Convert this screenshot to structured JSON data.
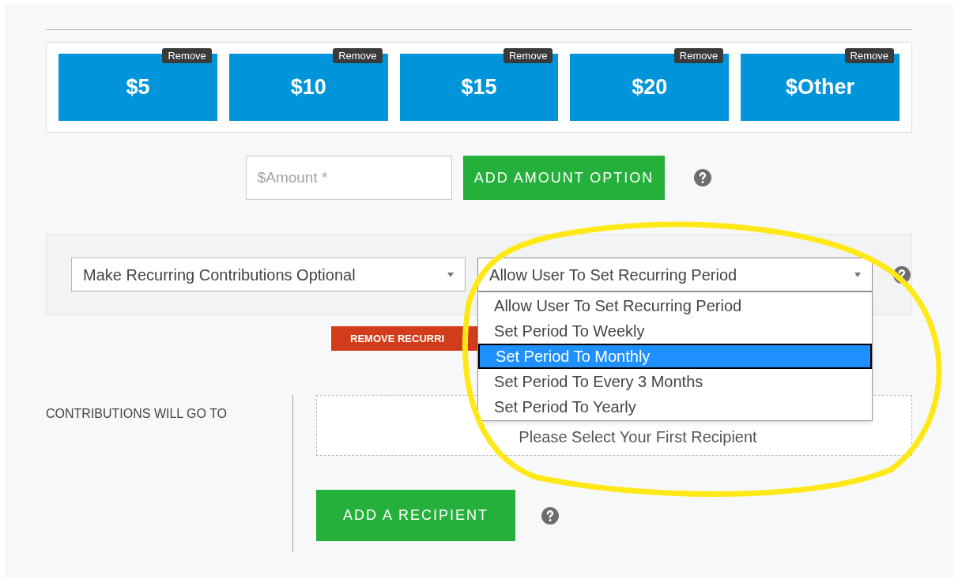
{
  "amount_options": [
    {
      "label": "$5",
      "remove": "Remove"
    },
    {
      "label": "$10",
      "remove": "Remove"
    },
    {
      "label": "$15",
      "remove": "Remove"
    },
    {
      "label": "$20",
      "remove": "Remove"
    },
    {
      "label": "$Other",
      "remove": "Remove"
    }
  ],
  "amount_field": {
    "placeholder": "$Amount *"
  },
  "add_amount_button": "ADD AMOUNT OPTION",
  "recurring": {
    "mode_select": {
      "value": "Make Recurring Contributions Optional"
    },
    "period_select": {
      "value": "Allow User To Set Recurring Period",
      "expanded": true,
      "options": [
        {
          "label": "Allow User To Set Recurring Period",
          "highlighted": false
        },
        {
          "label": "Set Period To Weekly",
          "highlighted": false
        },
        {
          "label": "Set Period To Monthly",
          "highlighted": true
        },
        {
          "label": "Set Period To Every 3 Months",
          "highlighted": false
        },
        {
          "label": "Set Period To Yearly",
          "highlighted": false
        }
      ]
    },
    "remove_button": "REMOVE RECURRI"
  },
  "recipients": {
    "label": "CONTRIBUTIONS WILL GO TO",
    "placeholder": "Please Select Your First Recipient",
    "add_button": "ADD A RECIPIENT"
  }
}
